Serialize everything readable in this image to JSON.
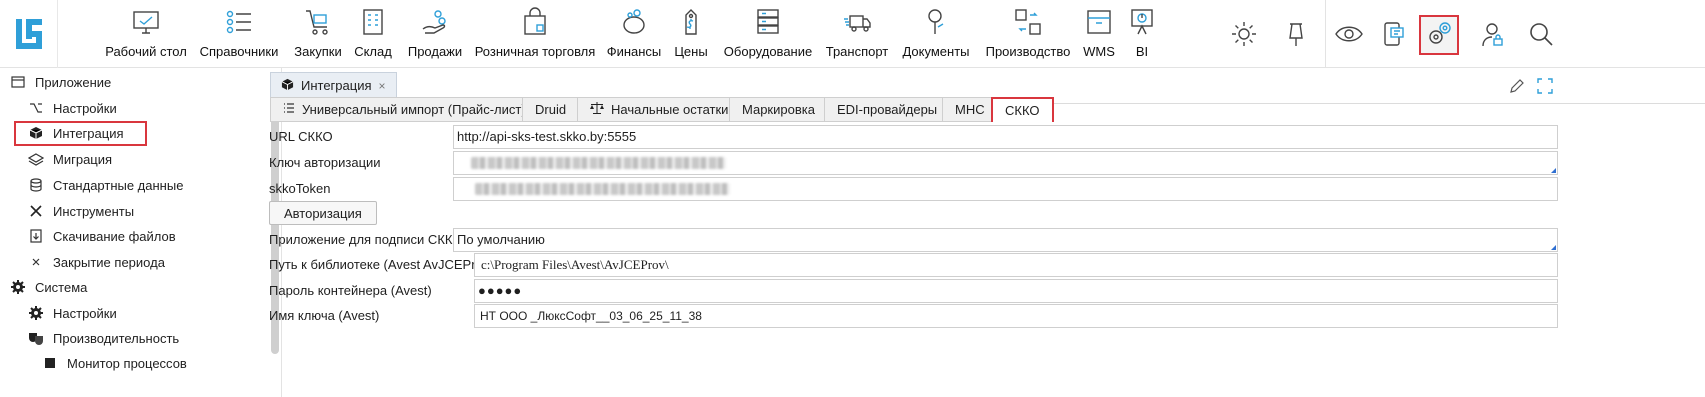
{
  "toolbar": {
    "modules": [
      {
        "label": "Рабочий стол",
        "icon": "desktop-icon"
      },
      {
        "label": "Справочники",
        "icon": "list-icon"
      },
      {
        "label": "Закупки",
        "icon": "cart-icon"
      },
      {
        "label": "Склад",
        "icon": "warehouse-icon"
      },
      {
        "label": "Продажи",
        "icon": "sales-icon"
      },
      {
        "label": "Розничная торговля",
        "icon": "shopping-bag-icon"
      },
      {
        "label": "Финансы",
        "icon": "piggy-bank-icon"
      },
      {
        "label": "Цены",
        "icon": "price-tag-icon"
      },
      {
        "label": "Оборудование",
        "icon": "server-icon"
      },
      {
        "label": "Транспорт",
        "icon": "truck-icon"
      },
      {
        "label": "Документы",
        "icon": "document-pen-icon"
      },
      {
        "label": "Производство",
        "icon": "production-icon"
      },
      {
        "label": "WMS",
        "icon": "wms-box-icon"
      },
      {
        "label": "BI",
        "icon": "bi-chart-icon"
      }
    ],
    "right_icons": [
      "sun-icon",
      "pin-icon",
      "eye-icon",
      "phone-chat-icon",
      "settings-gears-icon",
      "user-lock-icon",
      "search-icon"
    ]
  },
  "sidebar": {
    "items": [
      {
        "label": "Приложение",
        "icon": "window-icon",
        "level": 0
      },
      {
        "label": "Настройки",
        "icon": "option-icon",
        "level": 1
      },
      {
        "label": "Интеграция",
        "icon": "cube-icon",
        "level": 1,
        "selected": true
      },
      {
        "label": "Миграция",
        "icon": "layers-icon",
        "level": 1
      },
      {
        "label": "Стандартные данные",
        "icon": "database-icon",
        "level": 1
      },
      {
        "label": "Инструменты",
        "icon": "tools-icon",
        "level": 1
      },
      {
        "label": "Скачивание файлов",
        "icon": "download-file-icon",
        "level": 1
      },
      {
        "label": "Закрытие периода",
        "icon": "close-x-icon",
        "level": 1
      },
      {
        "label": "Система",
        "icon": "gear-icon",
        "level": 0
      },
      {
        "label": "Настройки",
        "icon": "gear-icon",
        "level": 1
      },
      {
        "label": "Производительность",
        "icon": "masks-icon",
        "level": 1
      },
      {
        "label": "Монитор процессов",
        "icon": "square-icon",
        "level": 2
      }
    ]
  },
  "main": {
    "doc_tab": {
      "label": "Интеграция",
      "close": "×"
    },
    "subtabs": [
      {
        "label": "Универсальный импорт (Прайс-лист)",
        "icon": "list-lines-icon"
      },
      {
        "label": "Druid"
      },
      {
        "label": "Начальные остатки",
        "icon": "scales-icon"
      },
      {
        "label": "Маркировка"
      },
      {
        "label": "EDI-провайдеры"
      },
      {
        "label": "МНС"
      },
      {
        "label": "СККО",
        "active": true
      }
    ],
    "form": {
      "url_label": "URL СККО",
      "url_value": "http://api-sks-test.skko.by:5555",
      "auth_key_label": "Ключ авторизации",
      "token_label": "skkoToken",
      "auth_button": "Авторизация",
      "sign_app_label": "Приложение для подписи СККО",
      "sign_app_value": "По умолчанию",
      "lib_path_label": "Путь к библиотеке (Avest AvJCEProv)",
      "lib_path_value": "c:\\Program Files\\Avest\\AvJCEProv\\",
      "container_pwd_label": "Пароль контейнера (Avest)",
      "container_pwd_value": "●●●●●",
      "key_name_label": "Имя ключа (Avest)",
      "key_name_value": "НТ ООО _ЛюксСофт__03_06_25_11_38"
    }
  },
  "colors": {
    "accent": "#2f9fd8",
    "highlight": "#d9363e"
  }
}
